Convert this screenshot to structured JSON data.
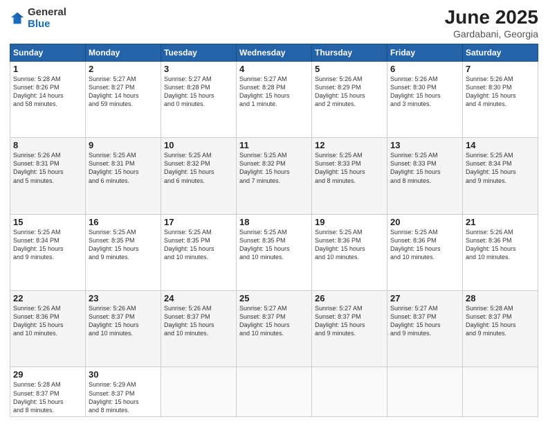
{
  "logo": {
    "general": "General",
    "blue": "Blue"
  },
  "title": "June 2025",
  "subtitle": "Gardabani, Georgia",
  "weekdays": [
    "Sunday",
    "Monday",
    "Tuesday",
    "Wednesday",
    "Thursday",
    "Friday",
    "Saturday"
  ],
  "weeks": [
    [
      {
        "day": 1,
        "info": "Sunrise: 5:28 AM\nSunset: 8:26 PM\nDaylight: 14 hours\nand 58 minutes."
      },
      {
        "day": 2,
        "info": "Sunrise: 5:27 AM\nSunset: 8:27 PM\nDaylight: 14 hours\nand 59 minutes."
      },
      {
        "day": 3,
        "info": "Sunrise: 5:27 AM\nSunset: 8:28 PM\nDaylight: 15 hours\nand 0 minutes."
      },
      {
        "day": 4,
        "info": "Sunrise: 5:27 AM\nSunset: 8:28 PM\nDaylight: 15 hours\nand 1 minute."
      },
      {
        "day": 5,
        "info": "Sunrise: 5:26 AM\nSunset: 8:29 PM\nDaylight: 15 hours\nand 2 minutes."
      },
      {
        "day": 6,
        "info": "Sunrise: 5:26 AM\nSunset: 8:30 PM\nDaylight: 15 hours\nand 3 minutes."
      },
      {
        "day": 7,
        "info": "Sunrise: 5:26 AM\nSunset: 8:30 PM\nDaylight: 15 hours\nand 4 minutes."
      }
    ],
    [
      {
        "day": 8,
        "info": "Sunrise: 5:26 AM\nSunset: 8:31 PM\nDaylight: 15 hours\nand 5 minutes."
      },
      {
        "day": 9,
        "info": "Sunrise: 5:25 AM\nSunset: 8:31 PM\nDaylight: 15 hours\nand 6 minutes."
      },
      {
        "day": 10,
        "info": "Sunrise: 5:25 AM\nSunset: 8:32 PM\nDaylight: 15 hours\nand 6 minutes."
      },
      {
        "day": 11,
        "info": "Sunrise: 5:25 AM\nSunset: 8:32 PM\nDaylight: 15 hours\nand 7 minutes."
      },
      {
        "day": 12,
        "info": "Sunrise: 5:25 AM\nSunset: 8:33 PM\nDaylight: 15 hours\nand 8 minutes."
      },
      {
        "day": 13,
        "info": "Sunrise: 5:25 AM\nSunset: 8:33 PM\nDaylight: 15 hours\nand 8 minutes."
      },
      {
        "day": 14,
        "info": "Sunrise: 5:25 AM\nSunset: 8:34 PM\nDaylight: 15 hours\nand 9 minutes."
      }
    ],
    [
      {
        "day": 15,
        "info": "Sunrise: 5:25 AM\nSunset: 8:34 PM\nDaylight: 15 hours\nand 9 minutes."
      },
      {
        "day": 16,
        "info": "Sunrise: 5:25 AM\nSunset: 8:35 PM\nDaylight: 15 hours\nand 9 minutes."
      },
      {
        "day": 17,
        "info": "Sunrise: 5:25 AM\nSunset: 8:35 PM\nDaylight: 15 hours\nand 10 minutes."
      },
      {
        "day": 18,
        "info": "Sunrise: 5:25 AM\nSunset: 8:35 PM\nDaylight: 15 hours\nand 10 minutes."
      },
      {
        "day": 19,
        "info": "Sunrise: 5:25 AM\nSunset: 8:36 PM\nDaylight: 15 hours\nand 10 minutes."
      },
      {
        "day": 20,
        "info": "Sunrise: 5:25 AM\nSunset: 8:36 PM\nDaylight: 15 hours\nand 10 minutes."
      },
      {
        "day": 21,
        "info": "Sunrise: 5:26 AM\nSunset: 8:36 PM\nDaylight: 15 hours\nand 10 minutes."
      }
    ],
    [
      {
        "day": 22,
        "info": "Sunrise: 5:26 AM\nSunset: 8:36 PM\nDaylight: 15 hours\nand 10 minutes."
      },
      {
        "day": 23,
        "info": "Sunrise: 5:26 AM\nSunset: 8:37 PM\nDaylight: 15 hours\nand 10 minutes."
      },
      {
        "day": 24,
        "info": "Sunrise: 5:26 AM\nSunset: 8:37 PM\nDaylight: 15 hours\nand 10 minutes."
      },
      {
        "day": 25,
        "info": "Sunrise: 5:27 AM\nSunset: 8:37 PM\nDaylight: 15 hours\nand 10 minutes."
      },
      {
        "day": 26,
        "info": "Sunrise: 5:27 AM\nSunset: 8:37 PM\nDaylight: 15 hours\nand 9 minutes."
      },
      {
        "day": 27,
        "info": "Sunrise: 5:27 AM\nSunset: 8:37 PM\nDaylight: 15 hours\nand 9 minutes."
      },
      {
        "day": 28,
        "info": "Sunrise: 5:28 AM\nSunset: 8:37 PM\nDaylight: 15 hours\nand 9 minutes."
      }
    ],
    [
      {
        "day": 29,
        "info": "Sunrise: 5:28 AM\nSunset: 8:37 PM\nDaylight: 15 hours\nand 8 minutes."
      },
      {
        "day": 30,
        "info": "Sunrise: 5:29 AM\nSunset: 8:37 PM\nDaylight: 15 hours\nand 8 minutes."
      },
      {
        "day": null,
        "info": ""
      },
      {
        "day": null,
        "info": ""
      },
      {
        "day": null,
        "info": ""
      },
      {
        "day": null,
        "info": ""
      },
      {
        "day": null,
        "info": ""
      }
    ]
  ]
}
